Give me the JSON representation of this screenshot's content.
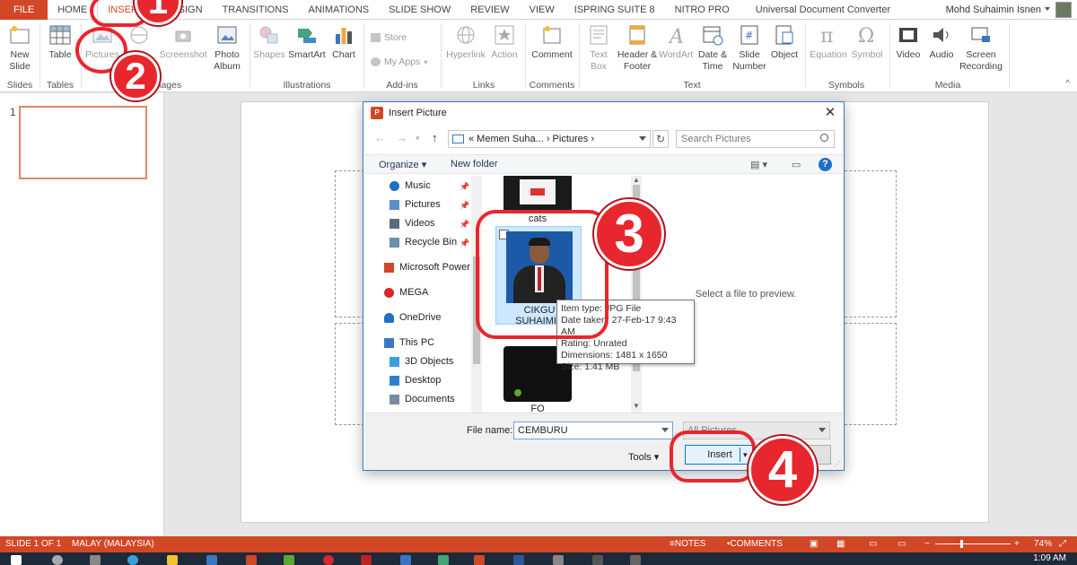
{
  "ribbon_tabs": [
    "FILE",
    "HOME",
    "INSERT",
    "DESIGN",
    "TRANSITIONS",
    "ANIMATIONS",
    "SLIDE SHOW",
    "REVIEW",
    "VIEW",
    "ISPRING SUITE 8",
    "NITRO PRO",
    "Universal Document Converter"
  ],
  "active_tab": "INSERT",
  "user_name": "Mohd Suhaimin Isnen",
  "ribbon": {
    "new_slide": "New Slide",
    "table": "Table",
    "pictures": "Pictures",
    "online_pictures": "Online Pictures",
    "screenshot": "Screenshot",
    "photo_album": "Photo Album",
    "shapes": "Shapes",
    "smartart": "SmartArt",
    "chart": "Chart",
    "store": "Store",
    "my_apps": "My Apps",
    "hyperlink": "Hyperlink",
    "action": "Action",
    "comment": "Comment",
    "text_box": "Text Box",
    "header_footer": "Header & Footer",
    "wordart": "WordArt",
    "date_time": "Date & Time",
    "slide_number": "Slide Number",
    "object": "Object",
    "equation": "Equation",
    "symbol": "Symbol",
    "video": "Video",
    "audio": "Audio",
    "screen_recording": "Screen Recording",
    "groups": {
      "slides": "Slides",
      "tables": "Tables",
      "images": "Images",
      "illustrations": "Illustrations",
      "addins": "Add-ins",
      "links": "Links",
      "comments": "Comments",
      "text": "Text",
      "symbols": "Symbols",
      "media": "Media"
    }
  },
  "thumb_number": "1",
  "dialog": {
    "title": "Insert Picture",
    "address": "« Memen Suha... › Pictures ›",
    "search_placeholder": "Search Pictures",
    "organize": "Organize",
    "new_folder": "New folder",
    "nav_items": [
      {
        "label": "Music",
        "color": "#1f6fc6"
      },
      {
        "label": "Pictures",
        "color": "#5a8fc9"
      },
      {
        "label": "Videos",
        "color": "#5a6b7a"
      },
      {
        "label": "Recycle Bin",
        "color": "#6b8fb0"
      },
      {
        "label": "Microsoft Power",
        "color": "#d24726"
      },
      {
        "label": "MEGA",
        "color": "#d9272e"
      },
      {
        "label": "OneDrive",
        "color": "#1f6fc6"
      },
      {
        "label": "This PC",
        "color": "#3b77c4"
      },
      {
        "label": "3D Objects",
        "color": "#3aa0d8"
      },
      {
        "label": "Desktop",
        "color": "#2f7fd1"
      },
      {
        "label": "Documents",
        "color": "#7b8a99"
      }
    ],
    "files": [
      {
        "label": "cats"
      },
      {
        "label": "CIKGU SUHAIMIN"
      },
      {
        "label": "FO"
      }
    ],
    "tooltip": {
      "type": "Item type: JPG File",
      "date": "Date taken: 27-Feb-17 9:43 AM",
      "rating": "Rating: Unrated",
      "dimensions": "Dimensions: 1481 x 1650",
      "size": "Size: 1.41 MB"
    },
    "preview_text": "Select a file to preview.",
    "file_name_label": "File name:",
    "file_name_value": "CEMBURU",
    "file_type": "All Pictures",
    "tools": "Tools",
    "insert": "Insert",
    "cancel": "Cancel"
  },
  "annotations": [
    "1",
    "2",
    "3",
    "4"
  ],
  "status": {
    "slide": "SLIDE 1 OF 1",
    "language": "MALAY (MALAYSIA)",
    "notes": "NOTES",
    "comments": "COMMENTS",
    "zoom": "74%"
  },
  "clock": "1:09 AM",
  "colors": {
    "accent": "#d24726",
    "annotation_red": "#e8262e",
    "dialog_border": "#3b77c4"
  }
}
